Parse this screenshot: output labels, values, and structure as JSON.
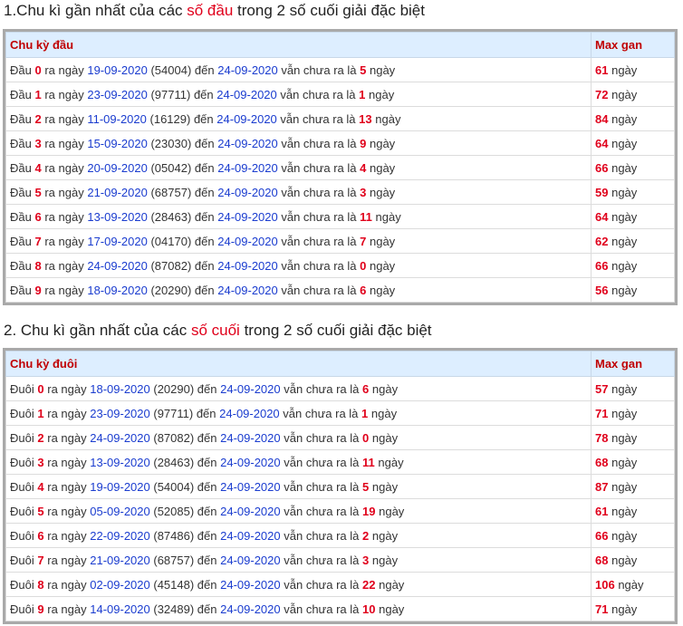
{
  "section1": {
    "heading_pre": "1.Chu kì gần nhất của các ",
    "heading_hl": "số đầu",
    "heading_post": " trong 2 số cuối giải đặc biệt",
    "col1": "Chu kỳ đầu",
    "col2": "Max gan",
    "prefix": "Đầu",
    "rows": [
      {
        "d": "0",
        "date": "19-09-2020",
        "code": "(54004)",
        "to": "24-09-2020",
        "n": "5",
        "max": "61"
      },
      {
        "d": "1",
        "date": "23-09-2020",
        "code": "(97711)",
        "to": "24-09-2020",
        "n": "1",
        "max": "72"
      },
      {
        "d": "2",
        "date": "11-09-2020",
        "code": "(16129)",
        "to": "24-09-2020",
        "n": "13",
        "max": "84"
      },
      {
        "d": "3",
        "date": "15-09-2020",
        "code": "(23030)",
        "to": "24-09-2020",
        "n": "9",
        "max": "64"
      },
      {
        "d": "4",
        "date": "20-09-2020",
        "code": "(05042)",
        "to": "24-09-2020",
        "n": "4",
        "max": "66"
      },
      {
        "d": "5",
        "date": "21-09-2020",
        "code": "(68757)",
        "to": "24-09-2020",
        "n": "3",
        "max": "59"
      },
      {
        "d": "6",
        "date": "13-09-2020",
        "code": "(28463)",
        "to": "24-09-2020",
        "n": "11",
        "max": "64"
      },
      {
        "d": "7",
        "date": "17-09-2020",
        "code": "(04170)",
        "to": "24-09-2020",
        "n": "7",
        "max": "62"
      },
      {
        "d": "8",
        "date": "24-09-2020",
        "code": "(87082)",
        "to": "24-09-2020",
        "n": "0",
        "max": "66"
      },
      {
        "d": "9",
        "date": "18-09-2020",
        "code": "(20290)",
        "to": "24-09-2020",
        "n": "6",
        "max": "56"
      }
    ]
  },
  "section2": {
    "heading_pre": "2. Chu kì gần nhất của các ",
    "heading_hl": "số cuối",
    "heading_post": " trong 2 số cuối giải đặc biệt",
    "col1": "Chu kỳ đuôi",
    "col2": "Max gan",
    "prefix": "Đuôi",
    "rows": [
      {
        "d": "0",
        "date": "18-09-2020",
        "code": "(20290)",
        "to": "24-09-2020",
        "n": "6",
        "max": "57"
      },
      {
        "d": "1",
        "date": "23-09-2020",
        "code": "(97711)",
        "to": "24-09-2020",
        "n": "1",
        "max": "71"
      },
      {
        "d": "2",
        "date": "24-09-2020",
        "code": "(87082)",
        "to": "24-09-2020",
        "n": "0",
        "max": "78"
      },
      {
        "d": "3",
        "date": "13-09-2020",
        "code": "(28463)",
        "to": "24-09-2020",
        "n": "11",
        "max": "68"
      },
      {
        "d": "4",
        "date": "19-09-2020",
        "code": "(54004)",
        "to": "24-09-2020",
        "n": "5",
        "max": "87"
      },
      {
        "d": "5",
        "date": "05-09-2020",
        "code": "(52085)",
        "to": "24-09-2020",
        "n": "19",
        "max": "61"
      },
      {
        "d": "6",
        "date": "22-09-2020",
        "code": "(87486)",
        "to": "24-09-2020",
        "n": "2",
        "max": "66"
      },
      {
        "d": "7",
        "date": "21-09-2020",
        "code": "(68757)",
        "to": "24-09-2020",
        "n": "3",
        "max": "68"
      },
      {
        "d": "8",
        "date": "02-09-2020",
        "code": "(45148)",
        "to": "24-09-2020",
        "n": "22",
        "max": "106"
      },
      {
        "d": "9",
        "date": "14-09-2020",
        "code": "(32489)",
        "to": "24-09-2020",
        "n": "10",
        "max": "71"
      }
    ]
  },
  "words": {
    "ra_ngay": "ra ngày",
    "den": "đến",
    "van_chua": "vẫn chưa ra là",
    "ngay": "ngày"
  },
  "colors": {
    "highlight": "#e0001b",
    "date_blue": "#1a3ccf",
    "header_bg": "#ddeeff"
  }
}
